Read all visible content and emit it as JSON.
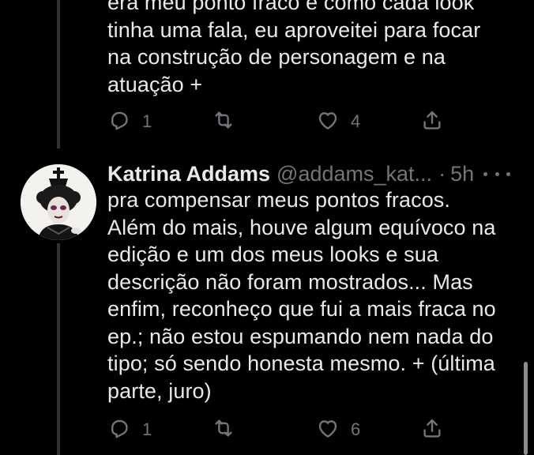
{
  "tweet1": {
    "text": "era meu ponto fraco e como cada look\ntinha uma fala, eu aproveitei para focar\nna construção de personagem e na\natuação +",
    "reply_count": "1",
    "retweet_count": "",
    "like_count": "4"
  },
  "tweet2": {
    "author_name": "Katrina Addams",
    "author_handle": "@addams_kat...",
    "separator": "·",
    "time": "5h",
    "text": "pra compensar meus pontos fracos.\nAlém do mais, houve algum equívoco na\nedição e um dos meus looks e sua\ndescrição não foram mostrados... Mas\nenfim, reconheço que fui a mais fraca no\nep.; não estou espumando nem nada do\ntipo; só sendo honesta mesmo. + (última\nparte, juro)",
    "reply_count": "1",
    "retweet_count": "",
    "like_count": "6"
  },
  "icons": {
    "reply": "reply-icon",
    "retweet": "retweet-icon",
    "like": "heart-icon",
    "share": "share-icon",
    "more": "more-icon"
  },
  "colors": {
    "background": "#000000",
    "text": "#e7e9ea",
    "muted": "#71767b",
    "thread_line": "#2f3336"
  }
}
